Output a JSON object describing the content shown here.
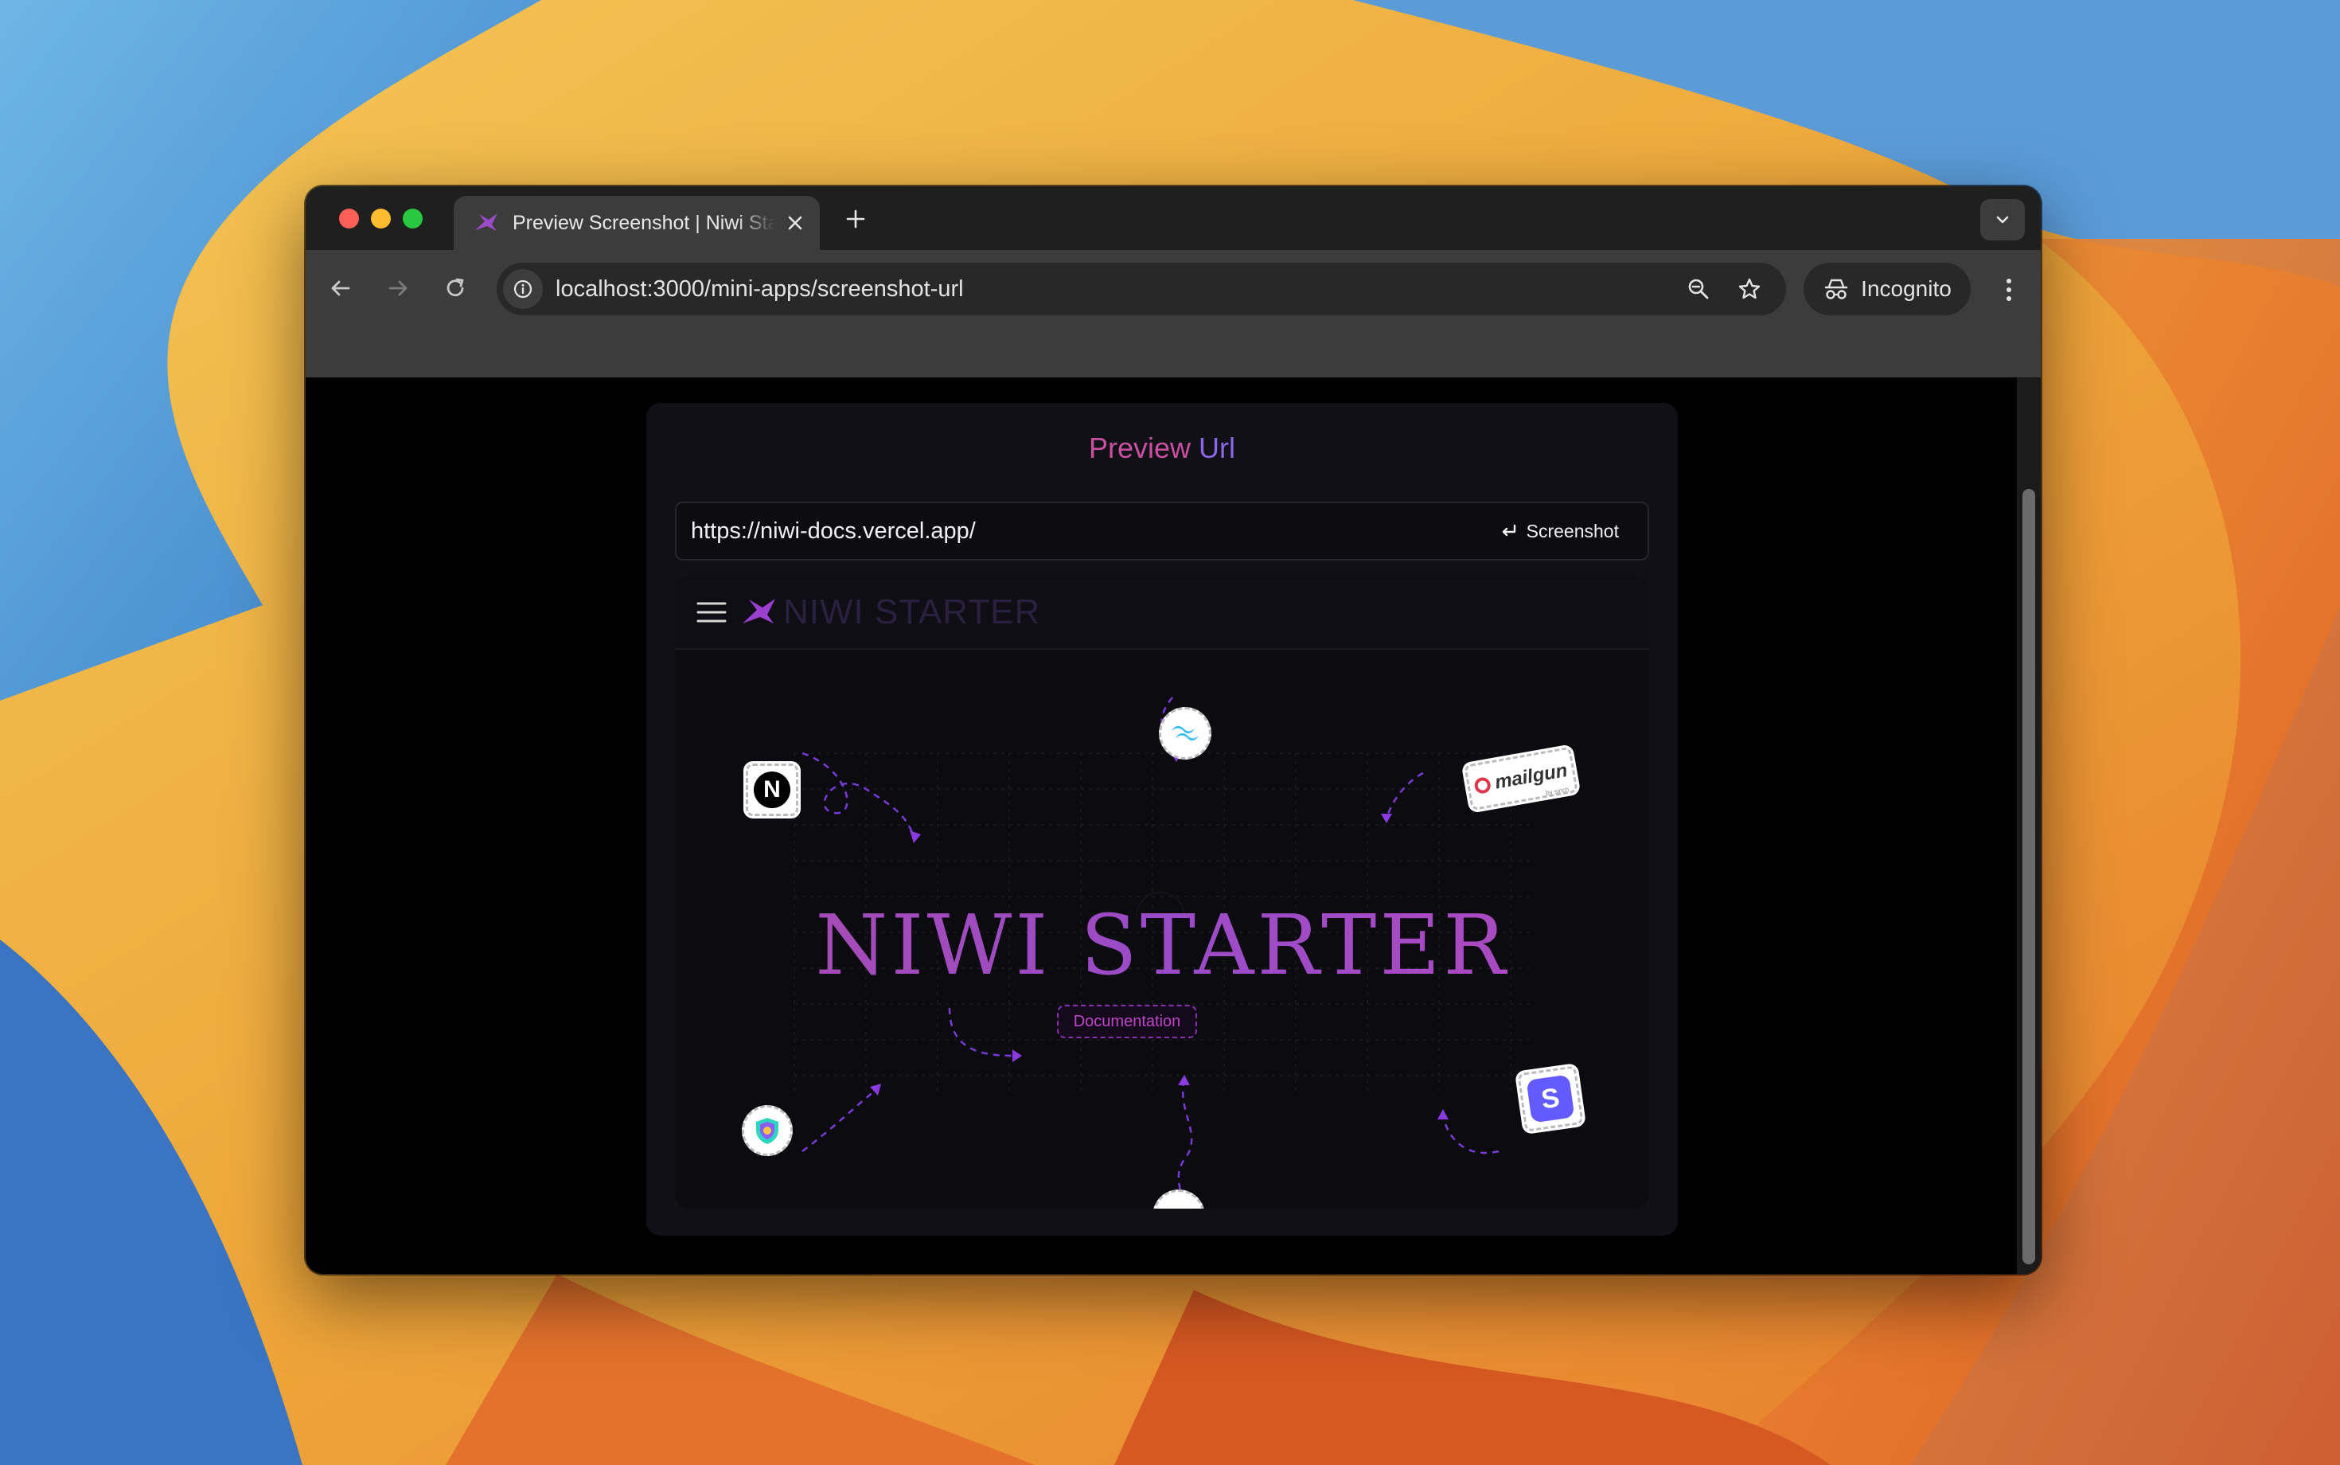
{
  "browser": {
    "tab": {
      "title": "Preview Screenshot | Niwi Starter"
    },
    "address_bar": {
      "url": "localhost:3000/mini-apps/screenshot-url"
    },
    "profile": {
      "label": "Incognito"
    }
  },
  "page": {
    "title_part1": "Preview",
    "title_part2": "Url",
    "url_input": {
      "value": "https://niwi-docs.vercel.app/"
    },
    "screenshot_button": {
      "label": "Screenshot"
    },
    "preview": {
      "brand_name": "NIWI STARTER",
      "hero_title": "NIWI STARTER",
      "doc_button_label": "Documentation",
      "logos": {
        "nextjs_letter": "N",
        "mailgun_label": "mailgun",
        "mailgun_sub": "by sinch",
        "stripe_letter": "S"
      }
    }
  },
  "colors": {
    "accent_pink": "#c94fa0",
    "accent_purple": "#8a66e8",
    "window_bg": "#000000",
    "toolbar_bg": "#3c3c3c"
  },
  "icons": {
    "tab_favicon": "niwi-bird-icon",
    "close": "close-icon",
    "new_tab": "plus-icon",
    "back": "arrow-left-icon",
    "forward": "arrow-right-icon",
    "reload": "reload-icon",
    "site_info": "info-icon",
    "zoom": "zoom-icon",
    "bookmark": "star-icon",
    "incognito": "incognito-icon",
    "menu": "kebab-menu-icon",
    "enter": "enter-icon",
    "hamburger": "hamburger-icon"
  }
}
